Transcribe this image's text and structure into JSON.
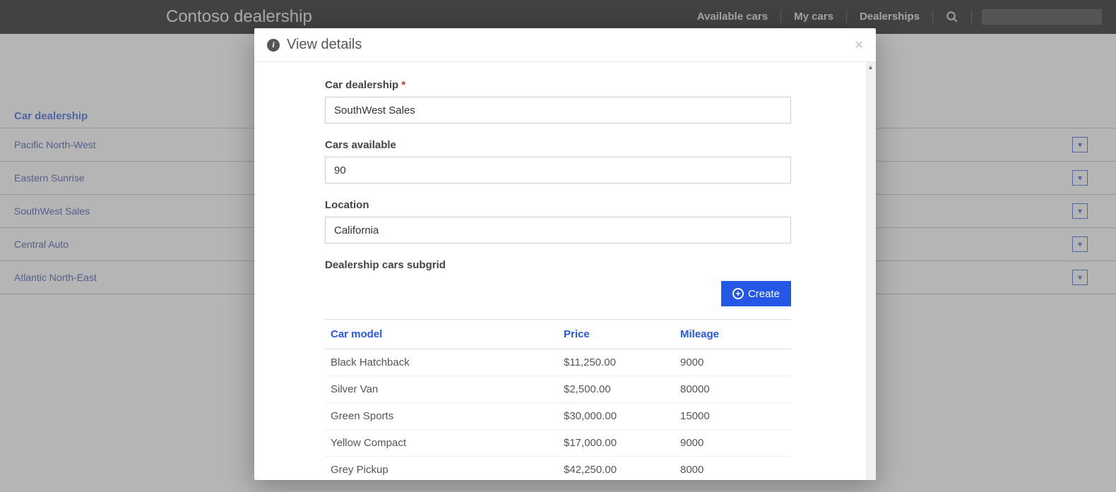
{
  "brand": "Contoso dealership",
  "nav": {
    "available": "Available cars",
    "mycars": "My cars",
    "dealerships": "Dealerships"
  },
  "bglist": {
    "header": "Car dealership",
    "rows": [
      "Pacific North-West",
      "Eastern Sunrise",
      "SouthWest Sales",
      "Central Auto",
      "Atlantic North-East"
    ]
  },
  "modal": {
    "title": "View details",
    "fields": {
      "dealership": {
        "label": "Car dealership",
        "required": "*",
        "value": "SouthWest Sales"
      },
      "available": {
        "label": "Cars available",
        "value": "90"
      },
      "location": {
        "label": "Location",
        "value": "California"
      }
    },
    "subgrid_label": "Dealership cars subgrid",
    "create_btn": "Create",
    "columns": {
      "model": "Car model",
      "price": "Price",
      "mileage": "Mileage"
    },
    "rows": [
      {
        "model": "Black Hatchback",
        "price": "$11,250.00",
        "mileage": "9000"
      },
      {
        "model": "Silver Van",
        "price": "$2,500.00",
        "mileage": "80000"
      },
      {
        "model": "Green Sports",
        "price": "$30,000.00",
        "mileage": "15000"
      },
      {
        "model": "Yellow Compact",
        "price": "$17,000.00",
        "mileage": "9000"
      },
      {
        "model": "Grey Pickup",
        "price": "$42,250.00",
        "mileage": "8000"
      }
    ]
  }
}
